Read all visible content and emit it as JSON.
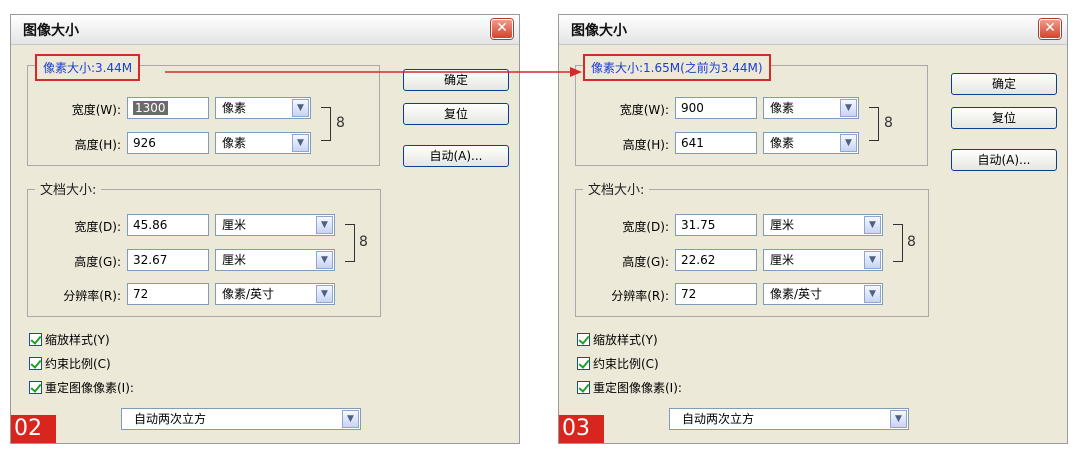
{
  "dialogs": [
    {
      "title": "图像大小",
      "step": "02",
      "pixel_size_label": "像素大小:3.44M",
      "pixel": {
        "width_label": "宽度(W):",
        "width_value": "1300",
        "width_unit": "像素",
        "height_label": "高度(H):",
        "height_value": "926",
        "height_unit": "像素"
      },
      "doc_size_label": "文档大小:",
      "doc": {
        "width_label": "宽度(D):",
        "width_value": "45.86",
        "width_unit": "厘米",
        "height_label": "高度(G):",
        "height_value": "32.67",
        "height_unit": "厘米",
        "resolution_label": "分辨率(R):",
        "resolution_value": "72",
        "resolution_unit": "像素/英寸"
      },
      "buttons": {
        "ok": "确定",
        "reset": "复位",
        "auto": "自动(A)..."
      },
      "checks": {
        "scale_styles": "缩放样式(Y)",
        "constrain": "约束比例(C)",
        "resample": "重定图像像素(I):"
      },
      "resample_method": "自动两次立方"
    },
    {
      "title": "图像大小",
      "step": "03",
      "pixel_size_label": "像素大小:1.65M(之前为3.44M)",
      "pixel": {
        "width_label": "宽度(W):",
        "width_value": "900",
        "width_unit": "像素",
        "height_label": "高度(H):",
        "height_value": "641",
        "height_unit": "像素"
      },
      "doc_size_label": "文档大小:",
      "doc": {
        "width_label": "宽度(D):",
        "width_value": "31.75",
        "width_unit": "厘米",
        "height_label": "高度(G):",
        "height_value": "22.62",
        "height_unit": "厘米",
        "resolution_label": "分辨率(R):",
        "resolution_value": "72",
        "resolution_unit": "像素/英寸"
      },
      "buttons": {
        "ok": "确定",
        "reset": "复位",
        "auto": "自动(A)..."
      },
      "checks": {
        "scale_styles": "缩放样式(Y)",
        "constrain": "约束比例(C)",
        "resample": "重定图像像素(I):"
      },
      "resample_method": "自动两次立方"
    }
  ],
  "colors": {
    "highlight": "#d42a2a",
    "legend_text": "#1a3fd1"
  }
}
